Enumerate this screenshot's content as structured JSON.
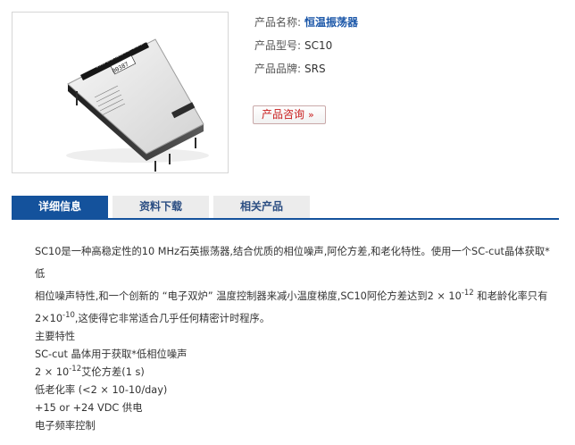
{
  "product": {
    "name_label": "产品名称:",
    "name_value": "恒温振荡器",
    "model_label": "产品型号:",
    "model_value": "SC10",
    "brand_label": "产品品牌:",
    "brand_value": "SRS",
    "consult_label": "产品咨询",
    "consult_chevron": "»",
    "image_text": {
      "brand_strip": "STANFORD RESEARCH SYSTEMS",
      "serial": "00387",
      "model_mark": "SC10"
    }
  },
  "tabs": [
    {
      "label": "详细信息",
      "active": true
    },
    {
      "label": "资料下载",
      "active": false
    },
    {
      "label": "相关产品",
      "active": false
    }
  ],
  "description": {
    "line1": "SC10是一种高稳定性的10 MHz石英振荡器,结合优质的相位噪声,阿伦方差,和老化特性。使用一个SC-cut晶体获取*低",
    "line2_pre": "相位噪声特性,和一个创新的 “电子双炉” 温度控制器来减小温度梯度,SC10阿伦方差达到2 × 10",
    "line2_exp": "-12",
    "line2_post": " 和老龄化率只有",
    "line3_pre": "2×10",
    "line3_exp": "-10",
    "line3_post": ",这使得它非常适合几乎任何精密计时程序。"
  },
  "features": {
    "title": "主要特性",
    "item1": "SC-cut 晶体用于获取*低相位噪声",
    "item2_pre": "2 × 10",
    "item2_exp": "-12",
    "item2_post": "艾伦方差(1 s)",
    "item3": "低老化率 (<2 × 10-10/day)",
    "item4": "+15 or +24 VDC 供电",
    "item5": "电子频率控制"
  },
  "colors": {
    "accent": "#14529c",
    "link": "#1a56a8",
    "consult": "#c81c1c",
    "tab_inactive": "#ececec"
  }
}
